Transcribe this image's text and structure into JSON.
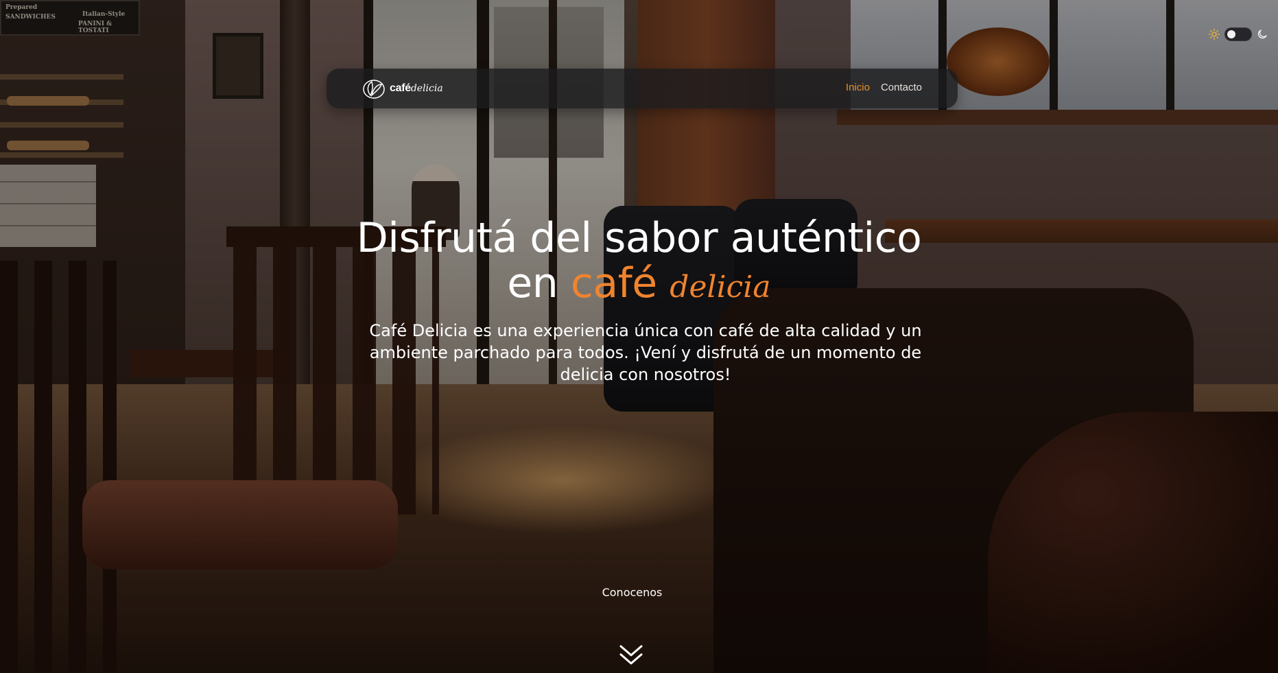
{
  "navbar": {
    "brand": {
      "logo_icon": "leaf-logo-icon",
      "word": "café",
      "script": "delicia"
    },
    "links": [
      {
        "label": "Inicio",
        "active": true
      },
      {
        "label": "Contacto",
        "active": false
      }
    ]
  },
  "theme_toggle": {
    "light_icon": "sun-icon",
    "dark_icon": "moon-icon",
    "state": "light"
  },
  "hero": {
    "title_line1": "Disfrutá del sabor auténtico",
    "title_line2_prefix": "en",
    "title_line2_accent": "café",
    "title_line2_script": "delicia",
    "subtitle": "Café Delicia es una experiencia única con café de alta calidad y un ambiente parchado para todos. ¡Vení y disfrutá de un momento de delicia con nosotros!",
    "cta_label": "Conocenos",
    "scroll_icon": "double-chevron-down-icon"
  },
  "background": {
    "sign_line1": "Prepared",
    "sign_line2": "SANDWICHES",
    "sign_line3": "Italian-Style",
    "sign_line4": "PANINI & TOSTATI"
  },
  "colors": {
    "accent": "#f0842f",
    "nav_active": "#e8922a",
    "navbar_bg": "#1c1c1e"
  }
}
